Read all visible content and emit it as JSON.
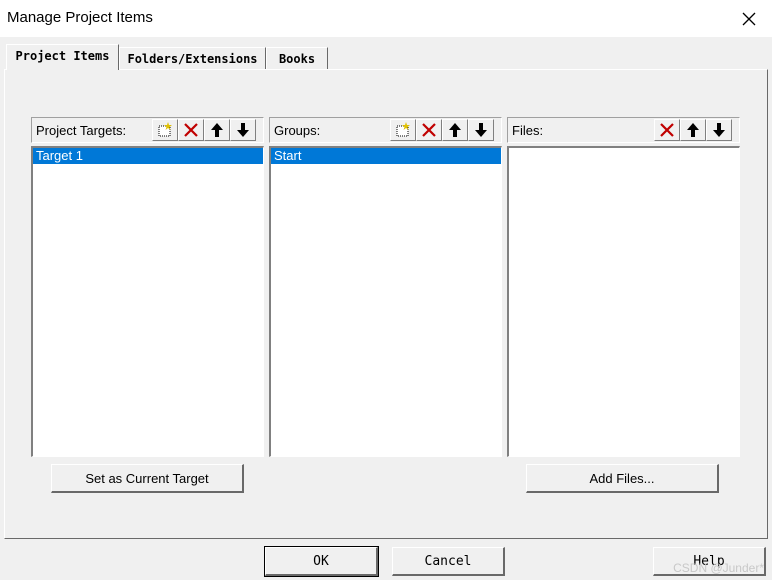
{
  "window": {
    "title": "Manage Project Items"
  },
  "tabs": [
    "Project Items",
    "Folders/Extensions",
    "Books"
  ],
  "targets": {
    "label": "Project Targets:",
    "items": [
      "Target 1"
    ],
    "button": "Set as Current Target"
  },
  "groups": {
    "label": "Groups:",
    "items": [
      "Start"
    ]
  },
  "files": {
    "label": "Files:",
    "items": [],
    "button": "Add Files..."
  },
  "footer": {
    "ok": "OK",
    "cancel": "Cancel",
    "help": "Help"
  },
  "watermark": "CSDN @Junder*",
  "colors": {
    "selection": "#0078d7",
    "delete_icon": "#c00000"
  },
  "icons": {
    "new": "new-item-icon",
    "delete": "delete-icon",
    "up": "move-up-icon",
    "down": "move-down-icon",
    "close": "close-icon"
  }
}
